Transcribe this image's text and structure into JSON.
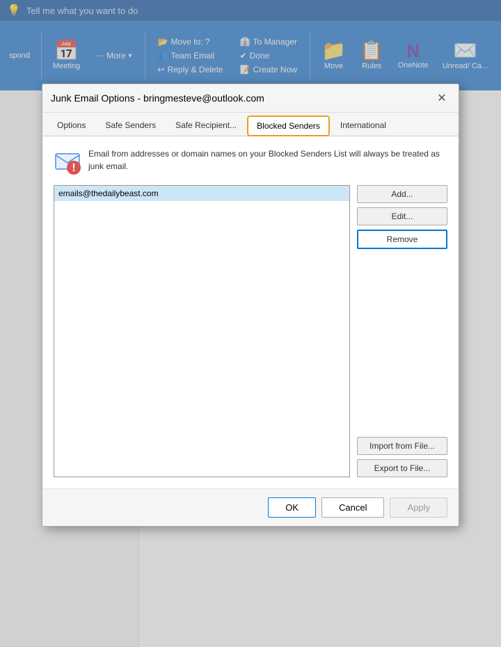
{
  "ribbon": {
    "search_placeholder": "Tell me what you want to do",
    "buttons": [
      {
        "label": "Meeting",
        "icon": "📅"
      },
      {
        "label": "More",
        "icon": "⋯",
        "has_dropdown": true
      },
      {
        "label": "Move",
        "icon": "📁"
      },
      {
        "label": "Rules",
        "icon": "📋"
      },
      {
        "label": "OneNote",
        "icon": "🟣"
      },
      {
        "label": "Unread/ Ca...",
        "icon": "✉️"
      }
    ],
    "small_buttons": [
      {
        "label": "Move to: ?"
      },
      {
        "label": "Team Email"
      },
      {
        "label": "Reply & Delete"
      },
      {
        "label": "To Manager"
      },
      {
        "label": "Done"
      },
      {
        "label": "Create Now"
      }
    ]
  },
  "dialog": {
    "title": "Junk Email Options - bringmesteve@outlook.com",
    "tabs": [
      {
        "label": "Options",
        "active": false
      },
      {
        "label": "Safe Senders",
        "active": false
      },
      {
        "label": "Safe Recipient...",
        "active": false
      },
      {
        "label": "Blocked Senders",
        "active": true,
        "highlighted": true
      },
      {
        "label": "International",
        "active": false
      }
    ],
    "info_text": "Email from addresses or domain names on your Blocked Senders List will always be treated as junk email.",
    "blocked_emails": [
      {
        "email": "emails@thedailybeast.com",
        "selected": true
      }
    ],
    "buttons": {
      "add": "Add...",
      "edit": "Edit...",
      "remove": "Remove",
      "import": "Import from File...",
      "export": "Export to File..."
    },
    "footer": {
      "ok": "OK",
      "cancel": "Cancel",
      "apply": "Apply"
    }
  }
}
